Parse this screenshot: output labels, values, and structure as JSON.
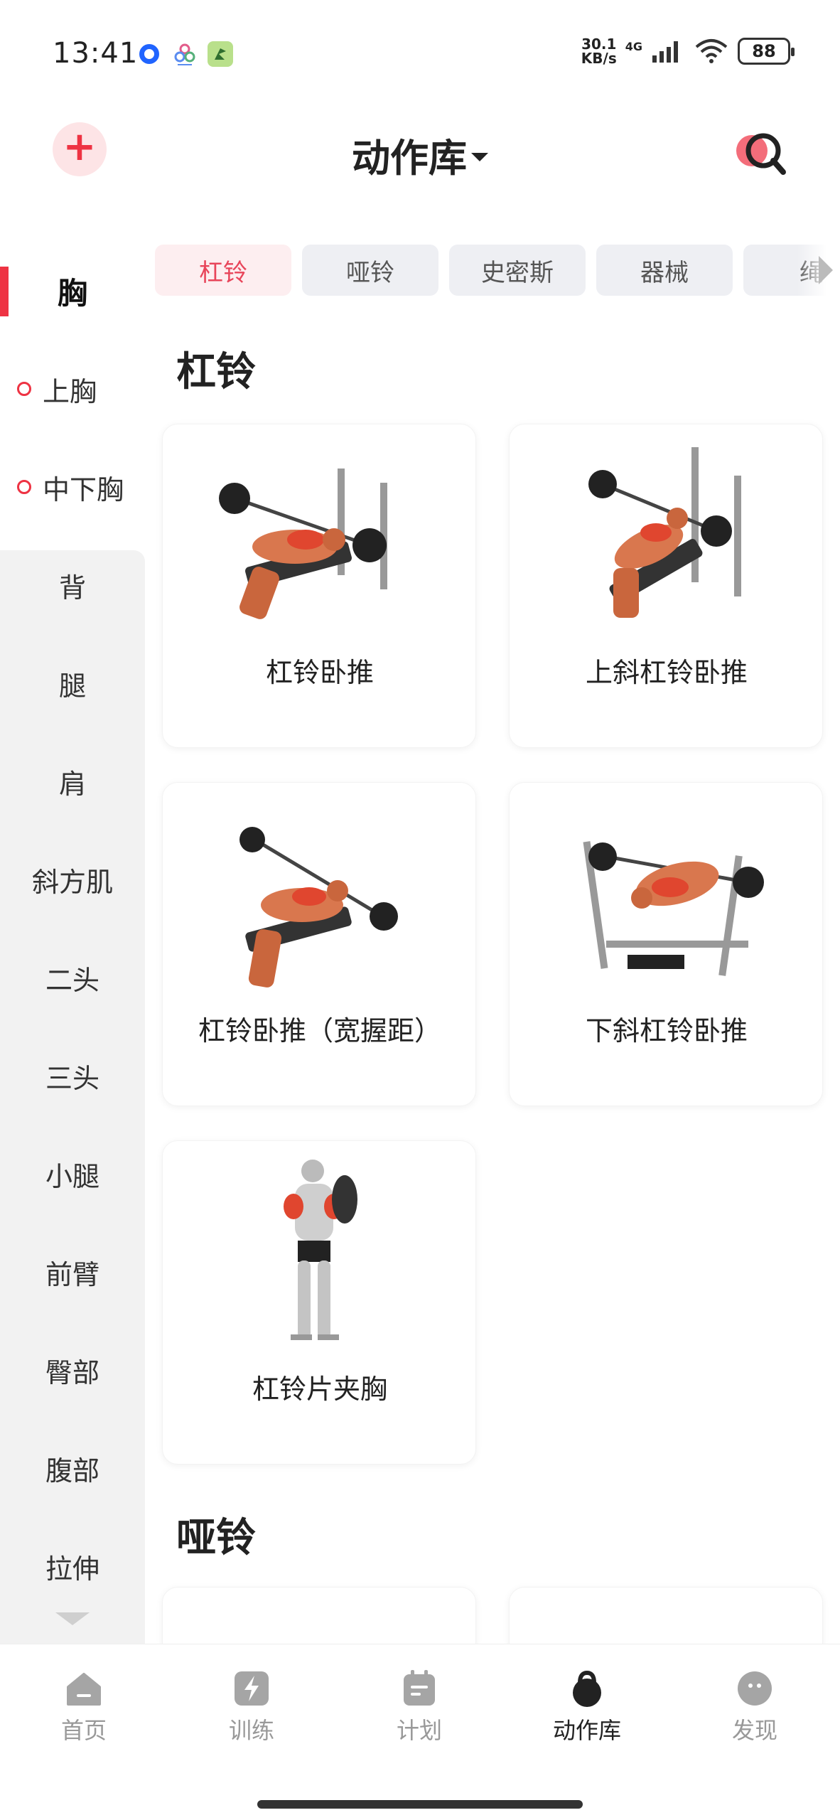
{
  "status_bar": {
    "time": "13:41",
    "net_speed_value": "30.1",
    "net_speed_unit": "KB/s",
    "network": "4G",
    "battery": "88"
  },
  "header": {
    "title": "动作库",
    "add_icon": "plus-icon",
    "search_icon": "search-icon"
  },
  "sidebar": {
    "items": [
      {
        "label": "胸"
      },
      {
        "label": "上胸"
      },
      {
        "label": "中下胸"
      },
      {
        "label": "背"
      },
      {
        "label": "腿"
      },
      {
        "label": "肩"
      },
      {
        "label": "斜方肌"
      },
      {
        "label": "二头"
      },
      {
        "label": "三头"
      },
      {
        "label": "小腿"
      },
      {
        "label": "前臂"
      },
      {
        "label": "臀部"
      },
      {
        "label": "腹部"
      },
      {
        "label": "拉伸"
      }
    ]
  },
  "filters": {
    "tabs": [
      {
        "label": "杠铃"
      },
      {
        "label": "哑铃"
      },
      {
        "label": "史密斯"
      },
      {
        "label": "器械"
      },
      {
        "label": "绳"
      }
    ]
  },
  "sections": [
    {
      "title": "杠铃",
      "exercises": [
        {
          "name": "杠铃卧推"
        },
        {
          "name": "上斜杠铃卧推"
        },
        {
          "name": "杠铃卧推（宽握距）"
        },
        {
          "name": "下斜杠铃卧推"
        },
        {
          "name": "杠铃片夹胸"
        }
      ]
    },
    {
      "title": "哑铃",
      "exercises": []
    }
  ],
  "bottom_nav": {
    "items": [
      {
        "label": "首页",
        "icon": "home-icon"
      },
      {
        "label": "训练",
        "icon": "lightning-icon"
      },
      {
        "label": "计划",
        "icon": "calendar-icon"
      },
      {
        "label": "动作库",
        "icon": "kettlebell-icon"
      },
      {
        "label": "发现",
        "icon": "discover-face-icon"
      }
    ]
  },
  "colors": {
    "accent": "#ee3343",
    "tab_active_bg": "#fdeef0",
    "sidebar_bg": "#f2f2f2"
  }
}
